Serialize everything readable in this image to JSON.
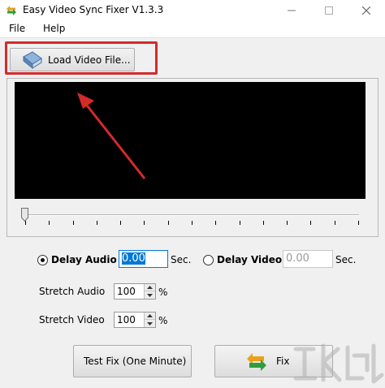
{
  "window": {
    "title": "Easy Video Sync Fixer V1.3.3"
  },
  "menu": {
    "file": "File",
    "help": "Help"
  },
  "load_button": {
    "label": "Load Video File..."
  },
  "delay": {
    "audio_label": "Delay Audio",
    "audio_value": "0.00",
    "audio_unit": "Sec.",
    "audio_selected": true,
    "video_label": "Delay Video",
    "video_value": "0.00",
    "video_unit": "Sec.",
    "video_selected": false
  },
  "stretch": {
    "audio_label": "Stretch Audio",
    "audio_value": "100",
    "audio_unit": "%",
    "video_label": "Stretch Video",
    "video_value": "100",
    "video_unit": "%"
  },
  "buttons": {
    "test_fix": "Test Fix (One Minute)",
    "fix": "Fix"
  },
  "seek_slider": {
    "position_fraction": 0.0
  },
  "colors": {
    "highlight": "#d42a2a",
    "accent": "#0078d7",
    "video_bg": "#000000"
  }
}
